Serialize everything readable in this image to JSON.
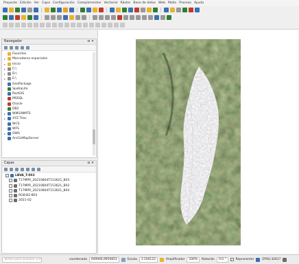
{
  "menu": [
    "Proyecto",
    "Edición",
    "Ver",
    "Capa",
    "Configuración",
    "Complementos",
    "Vectorial",
    "Ráster",
    "Base de datos",
    "Web",
    "Malla",
    "Proceso",
    "Ayuda"
  ],
  "toolbar_colors": {
    "row1": [
      "#3a6fb0",
      "#e7b333",
      "#2e7d32",
      "#3a6fb0",
      "#999999",
      "#3a6fb0",
      "sep",
      "#e7b333",
      "#2e7d32",
      "#3a6fb0",
      "#e8a020",
      "#3a6fb0",
      "sep",
      "#2e7d32",
      "#3a6fb0",
      "#e7b333",
      "#c0392b",
      "sep",
      "#3a6fb0",
      "#e7b333",
      "#2e7d32",
      "#3a6fb0",
      "#c0392b",
      "#999999",
      "#e7b333",
      "#2e7d32",
      "sep",
      "#3a6fb0",
      "#e7b333",
      "#999999",
      "#2e7d32",
      "#c0392b",
      "#3a6fb0"
    ],
    "row2": [
      "#2e7d32",
      "#3a6fb0",
      "#c0392b",
      "#e7b333",
      "#2e7d32",
      "#3a6fb0",
      "sep",
      "#999999",
      "#999999",
      "#999999",
      "#3a6fb0",
      "#e7b333",
      "#999999",
      "#999999",
      "sep",
      "#999999",
      "#999999",
      "#999999",
      "#999999",
      "#c0392b",
      "#999999",
      "#999999",
      "#999999",
      "#999999",
      "#999999",
      "#3a6fb0",
      "#999999",
      "#2e7d32"
    ],
    "row3": [
      "#c9c9c9",
      "#c9c9c9",
      "#c9c9c9",
      "#c9c9c9",
      "#c9c9c9",
      "#c9c9c9",
      "#c9c9c9",
      "#c9c9c9",
      "#c9c9c9",
      "#c9c9c9",
      "#c9c9c9",
      "#c9c9c9",
      "#c9c9c9",
      "#c9c9c9",
      "#c9c9c9",
      "#c9c9c9",
      "#c9c9c9",
      "#c9c9c9",
      "#c9c9c9",
      "#c9c9c9"
    ]
  },
  "navigator": {
    "title": "Navegador",
    "close": "⊡ ✕",
    "items": [
      {
        "label": "Favoritos",
        "exp": "",
        "color": "#e7b333"
      },
      {
        "label": "Marcadores espaciales",
        "exp": "▸",
        "color": "#e7b333"
      },
      {
        "label": "Inicio",
        "exp": "▸",
        "color": "#e7b333"
      },
      {
        "label": "C:\\",
        "exp": "▸",
        "color": "#8d8d8d"
      },
      {
        "label": "D:\\",
        "exp": "▸",
        "color": "#8d8d8d"
      },
      {
        "label": "E:\\",
        "exp": "▸",
        "color": "#8d8d8d"
      },
      {
        "label": "GeoPackage",
        "exp": "",
        "color": "#3a6fb0"
      },
      {
        "label": "SpatiaLite",
        "exp": "",
        "color": "#2e7d32"
      },
      {
        "label": "PostGIS",
        "exp": "",
        "color": "#3a6fb0"
      },
      {
        "label": "MSSQL",
        "exp": "",
        "color": "#c0392b"
      },
      {
        "label": "Oracle",
        "exp": "",
        "color": "#c0392b"
      },
      {
        "label": "DB2",
        "exp": "",
        "color": "#2e7d32"
      },
      {
        "label": "WMS/WMTS",
        "exp": "▸",
        "color": "#3a6fb0"
      },
      {
        "label": "XYZ Tiles",
        "exp": "▸",
        "color": "#3a6fb0"
      },
      {
        "label": "WCS",
        "exp": "",
        "color": "#3a6fb0"
      },
      {
        "label": "WFS",
        "exp": "",
        "color": "#3a6fb0"
      },
      {
        "label": "OWS",
        "exp": "▸",
        "color": "#3a6fb0"
      },
      {
        "label": "ArcGisMapServer",
        "exp": "",
        "color": "#3a6fb0"
      }
    ]
  },
  "layers": {
    "title": "Capas",
    "close": "⊡ ✕",
    "items": [
      {
        "label": "LBVA_T-002",
        "bold": true,
        "checked": true,
        "color": "#3a6fb0"
      },
      {
        "label": "T17MPR_20210804T153621_B03",
        "bold": false,
        "checked": false,
        "color": "#6b6b6b"
      },
      {
        "label": "T17MPR_20210804T153621_B02",
        "bold": false,
        "checked": false,
        "color": "#6b6b6b"
      },
      {
        "label": "T17MPR_20210804T153621_B04",
        "bold": false,
        "checked": false,
        "color": "#6b6b6b"
      },
      {
        "label": "RGB-B2-B03",
        "bold": false,
        "checked": false,
        "color": "#6b6b6b"
      },
      {
        "label": "2021-02",
        "bold": false,
        "checked": false,
        "color": "#6b6b6b"
      }
    ]
  },
  "status": {
    "locator_placeholder": "Teclee para localizar (Ctrl+K)",
    "coord_label": "coordenada",
    "coord_value": "649946,9950853",
    "scale_label": "Escala",
    "scale_value": "1:104123",
    "magnifier_label": "Amplificador",
    "magnifier_value": "100%",
    "rotation_label": "Rotación",
    "rotation_value": "0.0 °",
    "render_label": "Representar",
    "crs_label": "EPSG:32617",
    "render_checked": true
  }
}
